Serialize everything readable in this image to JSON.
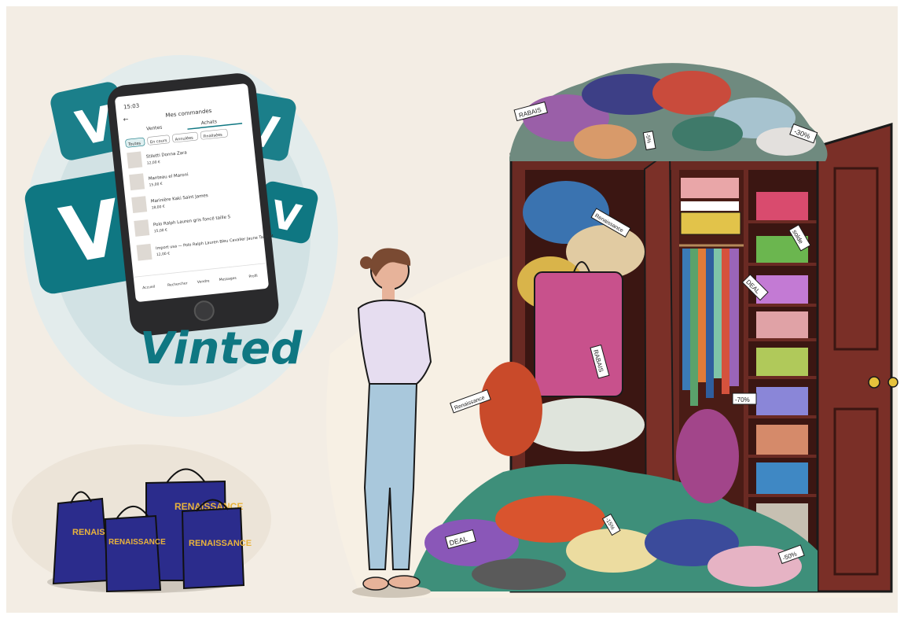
{
  "phone": {
    "time": "15:03",
    "title": "Mes commandes",
    "top_tabs": [
      "Ventes",
      "Achats"
    ],
    "filters": [
      "Toutes",
      "En cours",
      "Annulées",
      "Finalisées"
    ],
    "orders": [
      {
        "name": "Stiletti Donna Zara",
        "price": "12,00 €"
      },
      {
        "name": "Manteau el Maroni",
        "price": "15,00 €"
      },
      {
        "name": "Marinière Kaki Saint James",
        "price": "18,00 €"
      },
      {
        "name": "Polo Ralph Lauren gris foncé taille S",
        "price": "15,00 €"
      },
      {
        "name": "Import usa — Polo Ralph Lauren Bleu Cavalier Jaune Taille M",
        "price": "12,00 €"
      }
    ],
    "bottom_nav": [
      "Accueil",
      "Rechercher",
      "Vendre",
      "Messages",
      "Profil"
    ]
  },
  "brand": {
    "vinted_wordmark": "Vinted",
    "v_tile_letter": "V"
  },
  "bags": {
    "label": "RENAISSANCE"
  },
  "tags": {
    "rabais_1": "RABAIS",
    "rabais_2": "RABAIS",
    "discount_30": "-30%",
    "discount_50": "-50%",
    "discount_70": "-70%",
    "discount_5": "-5%",
    "discount_15": "-15%",
    "discount_50b": "-50%",
    "renaissance_1": "Renaissance",
    "renaissance_2": "Renaissance",
    "deal_1": "DEAL",
    "deal_2": "DEAL",
    "solde": "solde"
  },
  "colors": {
    "background": "#f3ede4",
    "vinted_teal": "#0f7782",
    "bag_navy": "#2b2c8c",
    "bag_text": "#e9b33c",
    "wardrobe": "#6a2a23"
  }
}
